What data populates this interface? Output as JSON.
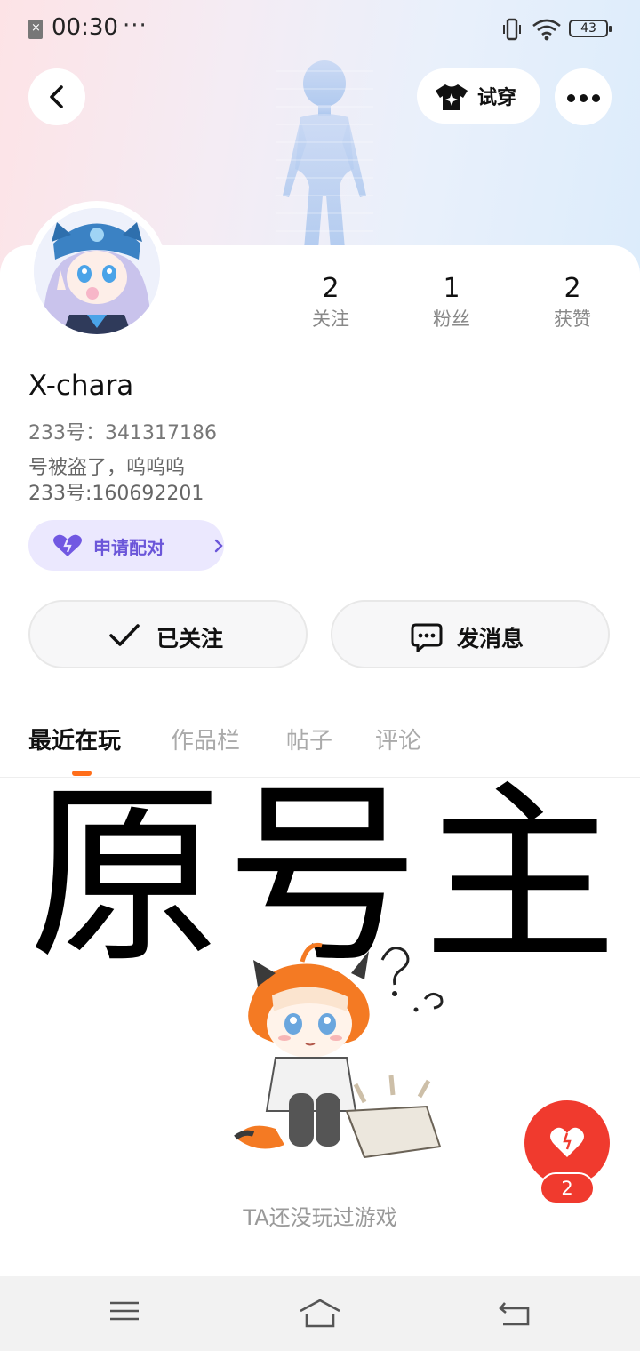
{
  "status_bar": {
    "time": "00:30",
    "dots": "···",
    "battery": "43"
  },
  "header": {
    "back_icon": "chevron-left-icon",
    "tryon_label": "试穿",
    "tryon_icon": "tshirt-sparkle-icon",
    "more_icon": "more-dots-icon"
  },
  "profile": {
    "stats": [
      {
        "count": "2",
        "label": "关注"
      },
      {
        "count": "1",
        "label": "粉丝"
      },
      {
        "count": "2",
        "label": "获赞"
      }
    ],
    "username": "X-chara",
    "user_id": "233号：341317186",
    "bio_lines": [
      "号被盗了，呜呜呜",
      "233号:160692201"
    ],
    "match_label": "申请配对",
    "match_color": "#6b56d9"
  },
  "actions": {
    "follow_label": "已关注",
    "message_label": "发消息"
  },
  "tabs": [
    {
      "label": "最近在玩",
      "active": true
    },
    {
      "label": "作品栏",
      "active": false
    },
    {
      "label": "帖子",
      "active": false
    },
    {
      "label": "评论",
      "active": false
    }
  ],
  "content": {
    "banner_chars": [
      "原",
      "号",
      "主"
    ],
    "empty_text": "TA还没玩过游戏"
  },
  "like": {
    "count": "2",
    "color": "#f03a2e"
  },
  "colors": {
    "tab_indicator": "#ff6e1a"
  }
}
